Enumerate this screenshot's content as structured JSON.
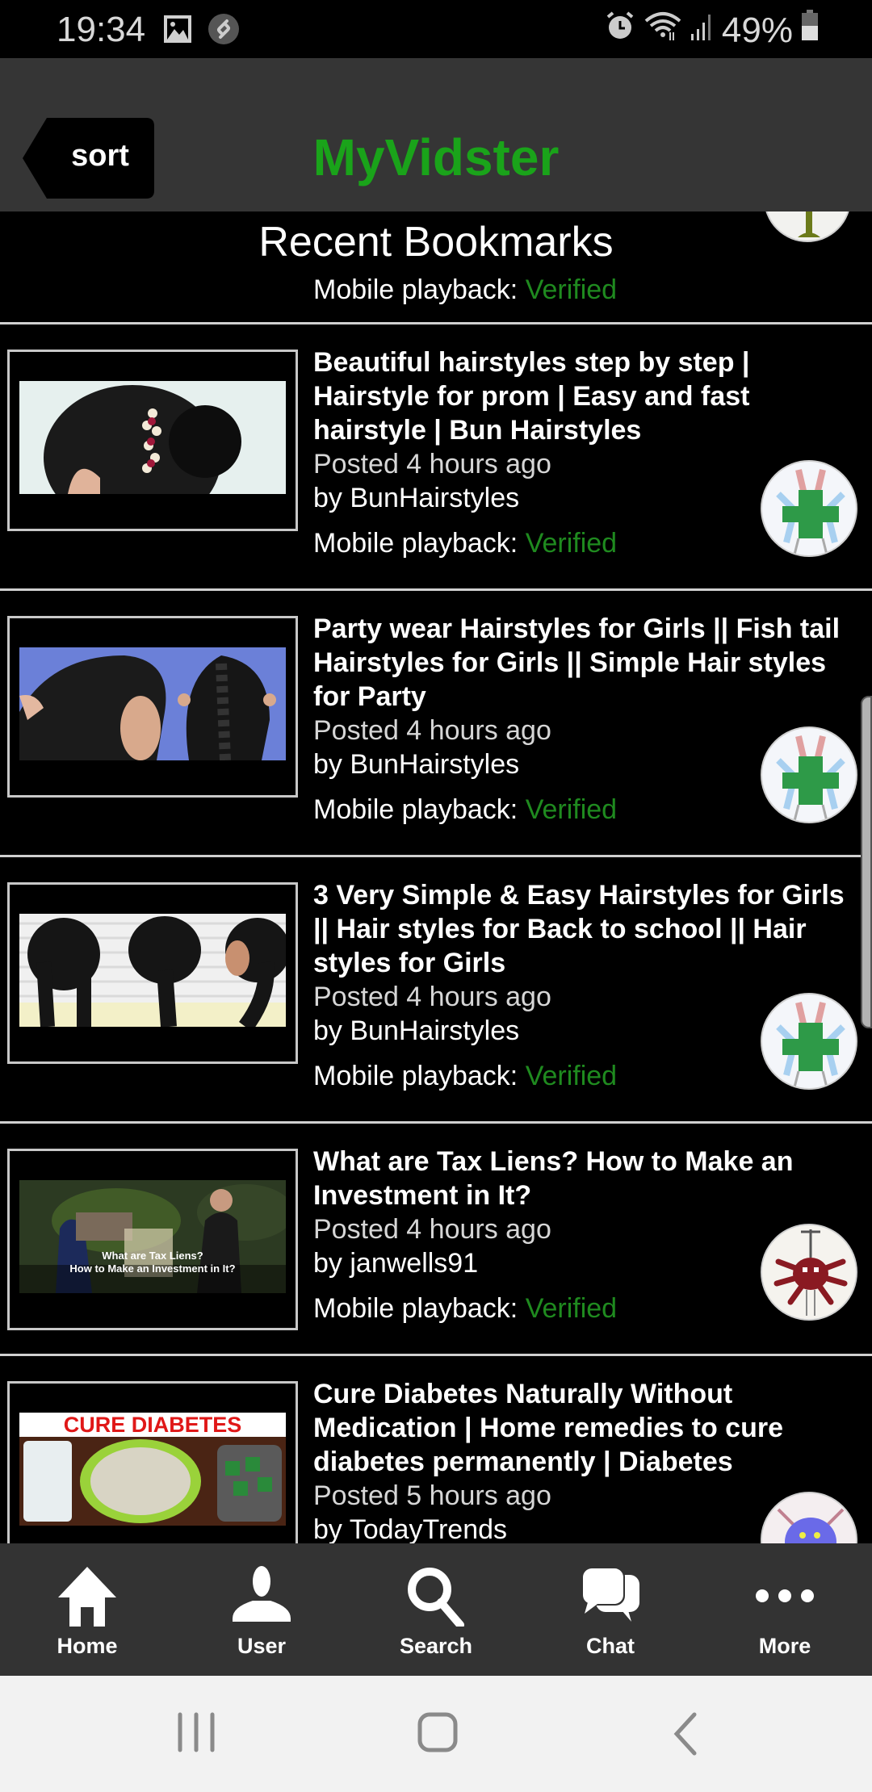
{
  "status_bar": {
    "time": "19:34",
    "battery": "49%",
    "left_icons": [
      "gallery-icon",
      "shazam-icon"
    ],
    "right_icons": [
      "alarm-icon",
      "wifi-icon",
      "signal-icon",
      "battery-icon"
    ]
  },
  "header": {
    "sort_label": "sort",
    "title": "MyVidster",
    "title_color": "#1aa31a"
  },
  "section": {
    "title": "Recent Bookmarks"
  },
  "playback_label": "Mobile playback: ",
  "verified_label": "Verified",
  "verified_color": "#1f8a1f",
  "partial_item": {
    "playback_label": "Mobile playback: ",
    "playback_status": "Verified"
  },
  "items": [
    {
      "title": "Beautiful hairstyles step by step | Hairstyle for prom | Easy and fast hairstyle | Bun Hairstyles",
      "posted": "Posted 4 hours ago",
      "by": "by BunHairstyles",
      "playback_label": "Mobile playback: ",
      "playback_status": "Verified",
      "thumbnail": "hair-bun-thumbnail"
    },
    {
      "title": "Party wear Hairstyles for Girls || Fish tail Hairstyles for Girls || Simple Hair styles for Party",
      "posted": "Posted 4 hours ago",
      "by": "by BunHairstyles",
      "playback_label": "Mobile playback: ",
      "playback_status": "Verified",
      "thumbnail": "fishtail-braid-thumbnail"
    },
    {
      "title": "3 Very Simple & Easy Hairstyles for Girls || Hair styles for Back to school || Hair styles for Girls",
      "posted": "Posted 4 hours ago",
      "by": "by BunHairstyles",
      "playback_label": "Mobile playback: ",
      "playback_status": "Verified",
      "thumbnail": "three-braids-thumbnail"
    },
    {
      "title": "What are Tax Liens? How to Make an Investment in It?",
      "posted": "Posted 4 hours ago",
      "by": "by janwells91",
      "playback_label": "Mobile playback: ",
      "playback_status": "Verified",
      "thumbnail": "tax-liens-thumbnail",
      "thumbnail_caption_1": "What are Tax Liens?",
      "thumbnail_caption_2": "How to Make an Investment in It?"
    },
    {
      "title": "Cure Diabetes Naturally Without Medication | Home remedies to cure diabetes permanently | Diabetes",
      "posted": "Posted 5 hours ago",
      "by": "by TodayTrends",
      "thumbnail": "cure-diabetes-thumbnail",
      "thumbnail_caption": "CURE DIABETES"
    }
  ],
  "bottom_nav": [
    {
      "label": "Home",
      "icon": "home-icon"
    },
    {
      "label": "User",
      "icon": "user-icon"
    },
    {
      "label": "Search",
      "icon": "search-icon"
    },
    {
      "label": "Chat",
      "icon": "chat-icon"
    },
    {
      "label": "More",
      "icon": "more-icon"
    }
  ],
  "system_nav": [
    "recents-button",
    "home-button",
    "back-button"
  ]
}
